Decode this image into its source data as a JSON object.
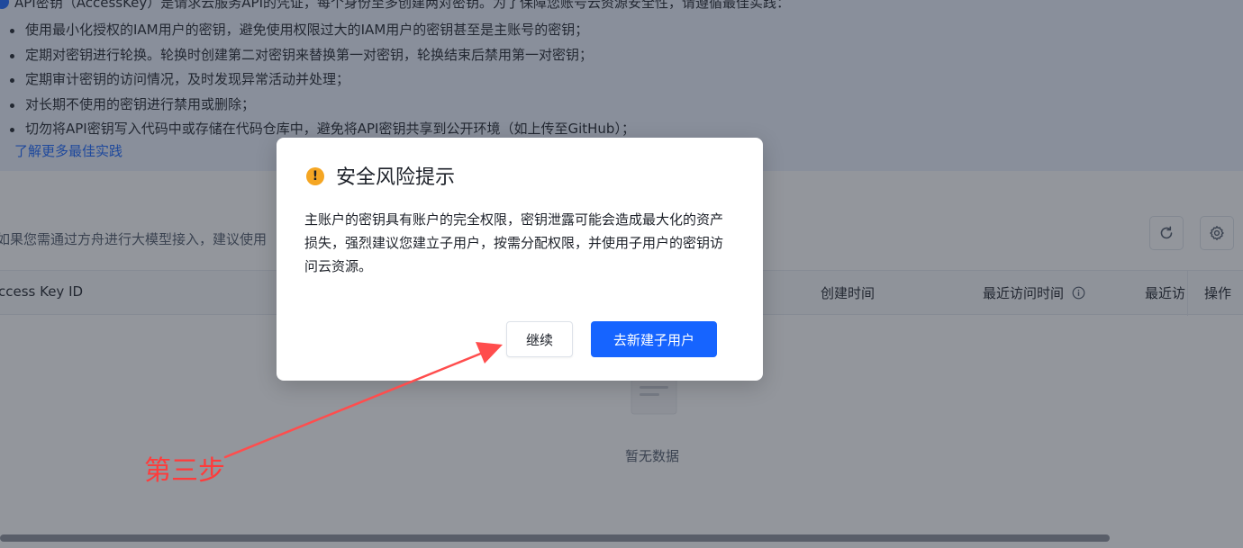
{
  "tips": {
    "intro": "API密钥（AccessKey）是请求云服务API的凭证，每个身份至多创建两对密钥。为了保障您账号云资源安全性，请遵循最佳实践：",
    "items": [
      "使用最小化授权的IAM用户的密钥，避免使用权限过大的IAM用户的密钥甚至是主账号的密钥；",
      "定期对密钥进行轮换。轮换时创建第二对密钥来替换第一对密钥，轮换结束后禁用第一对密钥；",
      "定期审计密钥的访问情况，及时发现异常活动并处理；",
      "对长期不使用的密钥进行禁用或删除；",
      "切勿将API密钥写入代码中或存储在代码仓库中，避免将API密钥共享到公开环境（如上传至GitHub）；"
    ],
    "learn_more": "了解更多最佳实践"
  },
  "toolbar": {
    "hint": "如果您需通过方舟进行大模型接入，建议使用",
    "refresh_icon": "refresh-icon",
    "settings_icon": "gear-icon"
  },
  "table": {
    "columns": {
      "access_key_id": "Access Key ID",
      "created_at": "创建时间",
      "last_access_time": "最近访问时间",
      "last_access_col": "最近访",
      "actions": "操作"
    },
    "empty_text": "暂无数据"
  },
  "modal": {
    "title": "安全风险提示",
    "body": "主账户的密钥具有账户的完全权限，密钥泄露可能会造成最大化的资产损失，强烈建议您建立子用户，按需分配权限，并使用子用户的密钥访问云资源。",
    "continue_label": "继续",
    "primary_label": "去新建子用户"
  },
  "annotation": {
    "label": "第三步"
  },
  "colors": {
    "primary": "#1664ff",
    "warning": "#f5a623",
    "annotation": "#ff3b3b"
  }
}
